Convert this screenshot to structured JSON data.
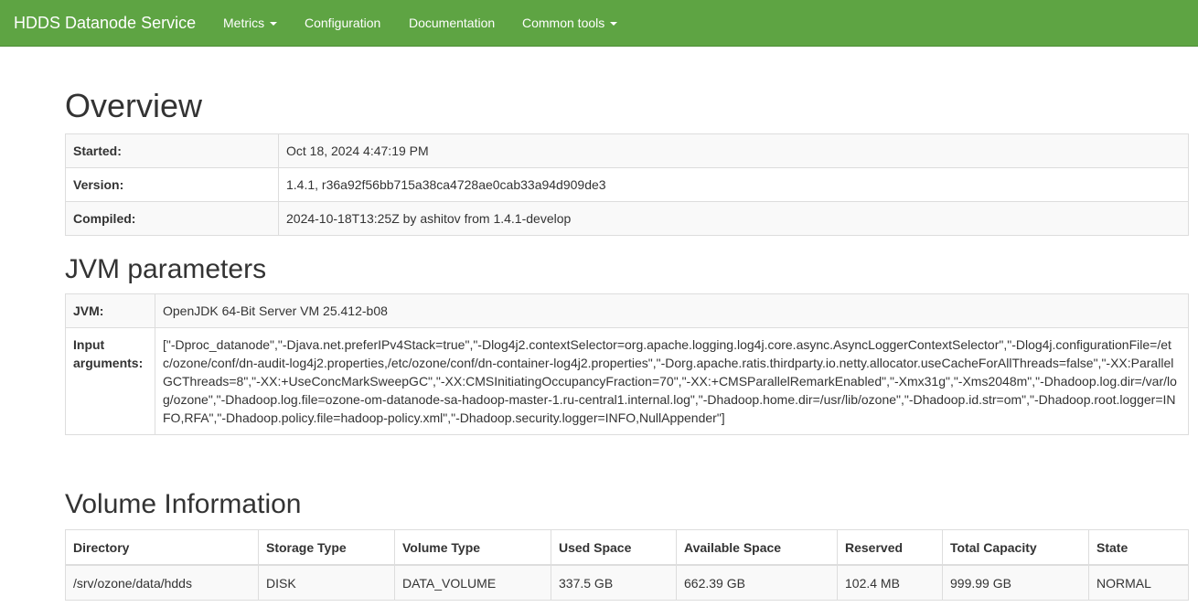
{
  "navbar": {
    "brand": "HDDS Datanode Service",
    "items": [
      {
        "label": "Metrics",
        "dropdown": true
      },
      {
        "label": "Configuration",
        "dropdown": false
      },
      {
        "label": "Documentation",
        "dropdown": false
      },
      {
        "label": "Common tools",
        "dropdown": true
      }
    ],
    "color": "#5ea443"
  },
  "overview": {
    "title": "Overview",
    "rows": [
      {
        "label": "Started:",
        "value": "Oct 18, 2024 4:47:19 PM"
      },
      {
        "label": "Version:",
        "value": "1.4.1, r36a92f56bb715a38ca4728ae0cab33a94d909de3"
      },
      {
        "label": "Compiled:",
        "value": "2024-10-18T13:25Z by ashitov from 1.4.1-develop"
      }
    ]
  },
  "jvm": {
    "title": "JVM parameters",
    "rows": [
      {
        "label": "JVM:",
        "value": "OpenJDK 64-Bit Server VM 25.412-b08"
      },
      {
        "label": "Input arguments:",
        "value": "[\"-Dproc_datanode\",\"-Djava.net.preferIPv4Stack=true\",\"-Dlog4j2.contextSelector=org.apache.logging.log4j.core.async.AsyncLoggerContextSelector\",\"-Dlog4j.configurationFile=/etc/ozone/conf/dn-audit-log4j2.properties,/etc/ozone/conf/dn-container-log4j2.properties\",\"-Dorg.apache.ratis.thirdparty.io.netty.allocator.useCacheForAllThreads=false\",\"-XX:ParallelGCThreads=8\",\"-XX:+UseConcMarkSweepGC\",\"-XX:CMSInitiatingOccupancyFraction=70\",\"-XX:+CMSParallelRemarkEnabled\",\"-Xmx31g\",\"-Xms2048m\",\"-Dhadoop.log.dir=/var/log/ozone\",\"-Dhadoop.log.file=ozone-om-datanode-sa-hadoop-master-1.ru-central1.internal.log\",\"-Dhadoop.home.dir=/usr/lib/ozone\",\"-Dhadoop.id.str=om\",\"-Dhadoop.root.logger=INFO,RFA\",\"-Dhadoop.policy.file=hadoop-policy.xml\",\"-Dhadoop.security.logger=INFO,NullAppender\"]"
      }
    ]
  },
  "volume": {
    "title": "Volume Information",
    "columns": [
      "Directory",
      "Storage Type",
      "Volume Type",
      "Used Space",
      "Available Space",
      "Reserved",
      "Total Capacity",
      "State"
    ],
    "rows": [
      [
        "/srv/ozone/data/hdds",
        "DISK",
        "DATA_VOLUME",
        "337.5 GB",
        "662.39 GB",
        "102.4 MB",
        "999.99 GB",
        "NORMAL"
      ]
    ]
  }
}
